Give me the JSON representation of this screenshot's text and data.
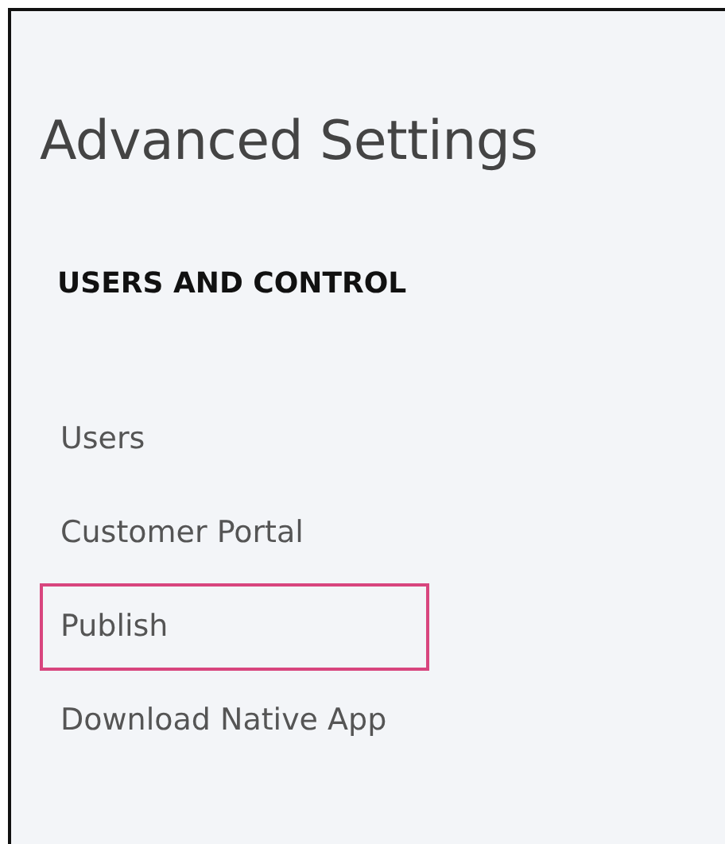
{
  "page": {
    "title": "Advanced Settings"
  },
  "section": {
    "heading": "USERS AND CONTROL",
    "items": [
      {
        "label": "Users",
        "highlighted": false
      },
      {
        "label": "Customer Portal",
        "highlighted": false
      },
      {
        "label": "Publish",
        "highlighted": true
      },
      {
        "label": "Download Native App",
        "highlighted": false
      }
    ]
  }
}
